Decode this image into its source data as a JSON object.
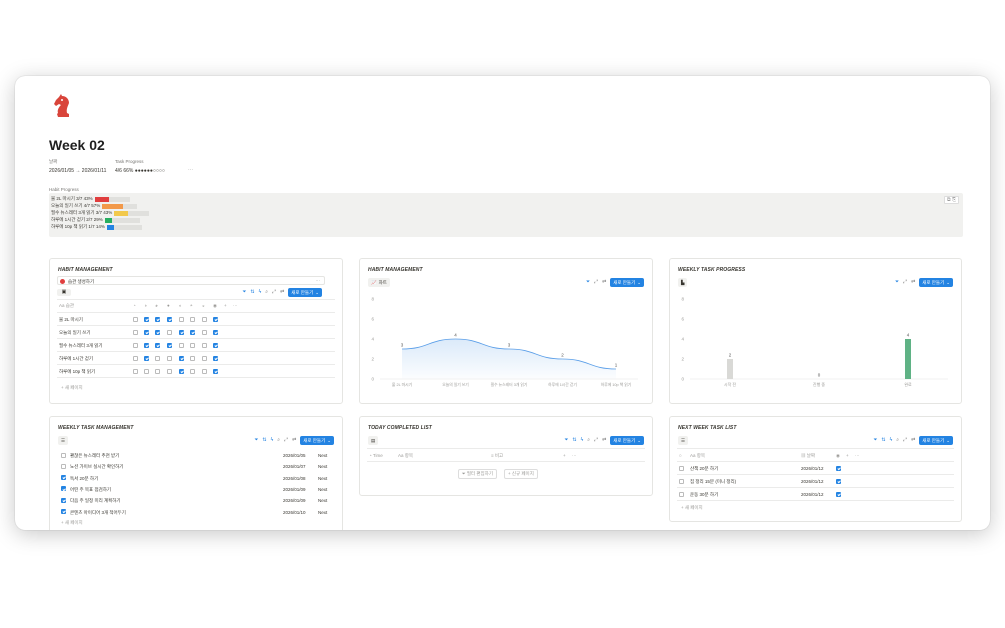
{
  "page": {
    "title": "Week 02",
    "icon": "chess-knight-icon",
    "date_label": "날짜",
    "date_value": "2026/01/05 → 2026/01/11",
    "task_label": "Task Progress",
    "task_value": "4/6 66% ●●●●●●○○○○",
    "more": "···"
  },
  "habit_progress": {
    "label": "Habit Progress",
    "rows": [
      {
        "text": "물 2L 마시기 3/7 43%",
        "fraction": 0.43,
        "color": "#e03e3e"
      },
      {
        "text": "오늘의 일기 쓰기 4/7 57%",
        "fraction": 0.57,
        "color": "#f2994a"
      },
      {
        "text": "필수 뉴스레터 3개 읽기 3/7 43%",
        "fraction": 0.43,
        "color": "#f2c94c"
      },
      {
        "text": "하루에 1시간 걷기 2/7 29%",
        "fraction": 0.29,
        "color": "#27ae60"
      },
      {
        "text": "하루에 10p 책 읽기 1/7 14%",
        "fraction": 0.14,
        "color": "#2383e2"
      }
    ]
  },
  "habit_card": {
    "title": "HABIT MANAGEMENT",
    "banner": "습관 생성하기",
    "banner_more": "···",
    "new_label": "새로 만들기",
    "col_name": "습관",
    "plus": "+",
    "more": "···",
    "rows": [
      {
        "name": "물 2L 마시기",
        "checks": [
          false,
          true,
          true,
          true,
          false,
          false,
          false,
          true
        ]
      },
      {
        "name": "오늘의 일기 쓰기",
        "checks": [
          false,
          true,
          true,
          false,
          true,
          true,
          false,
          true
        ]
      },
      {
        "name": "필수 뉴스레터 3개 읽기",
        "checks": [
          false,
          true,
          true,
          true,
          false,
          false,
          false,
          true
        ]
      },
      {
        "name": "하루에 1시간 걷기",
        "checks": [
          false,
          true,
          false,
          false,
          true,
          false,
          false,
          true
        ]
      },
      {
        "name": "하루에 10p 책 읽기",
        "checks": [
          false,
          false,
          false,
          false,
          true,
          false,
          false,
          true
        ]
      }
    ],
    "add_label": "새 페이지"
  },
  "chart_card": {
    "title": "HABIT MANAGEMENT",
    "view_label": "차트",
    "new_label": "새로 만들기"
  },
  "progress_card": {
    "title": "WEEKLY TASK PROGRESS",
    "new_label": "새로 만들기"
  },
  "weekly_card": {
    "title": "WEEKLY TASK MANAGEMENT",
    "new_label": "새로 만들기",
    "rows": [
      {
        "name": "괜찮은 뉴스레터 추천 받기",
        "date": "2026/01/05",
        "status": "Next",
        "done": false
      },
      {
        "name": "노션 가이브 실시간 확인하기",
        "date": "2026/01/07",
        "status": "Next",
        "done": false
      },
      {
        "name": "독서 20분 하기",
        "date": "2026/01/08",
        "status": "Next",
        "done": true
      },
      {
        "name": "어떤 주 목표 점검하기",
        "date": "2026/01/09",
        "status": "Next",
        "done": true
      },
      {
        "name": "다음 주 일정 미리 계획하기",
        "date": "2026/01/09",
        "status": "Next",
        "done": true
      },
      {
        "name": "콘텐츠 아이디어 3개 적어두기",
        "date": "2026/01/10",
        "status": "Next",
        "done": true
      }
    ],
    "add_label": "새 페이지"
  },
  "today_card": {
    "title": "TODAY COMPLETED LIST",
    "new_label": "새로 만들기",
    "col_time": "Time",
    "col_name": "항목",
    "col_note": "비고",
    "plus": "+",
    "more": "···",
    "filter_btn": "필터 편집하기",
    "new_page_btn": "신규 페이지"
  },
  "next_card": {
    "title": "NEXT WEEK TASK LIST",
    "new_label": "새로 만들기",
    "col_name": "항목",
    "col_date": "날짜",
    "plus": "+",
    "more": "···",
    "rows": [
      {
        "name": "산책 20분 하기",
        "date": "2026/01/12",
        "done": true
      },
      {
        "name": "집 정리 15분 (미니 정리)",
        "date": "2026/01/12",
        "done": true
      },
      {
        "name": "운동 30분 하기",
        "date": "2026/01/12",
        "done": true
      }
    ],
    "add_label": "새 페이지"
  },
  "chart_data": [
    {
      "type": "area",
      "title": "",
      "categories": [
        "물 2L 마시기",
        "오늘의 일기 쓰기",
        "필수 뉴스레터 3개 읽기",
        "하루에 1시간 걷기",
        "하루에 10p 책 읽기"
      ],
      "values": [
        3,
        4,
        3,
        2,
        1
      ],
      "yticks": [
        0,
        2,
        4,
        6,
        8
      ],
      "ylim": [
        0,
        8
      ],
      "color": "#5a9ee8"
    },
    {
      "type": "bar",
      "title": "",
      "categories": [
        "시작 전",
        "진행 중",
        "완료"
      ],
      "values": [
        2,
        0,
        4
      ],
      "colors": [
        "#d9d9d6",
        "#d9d9d6",
        "#5fb285"
      ],
      "yticks": [
        0,
        2,
        4,
        6,
        8
      ],
      "ylim": [
        0,
        8
      ]
    }
  ],
  "colors": {
    "accent": "#2383e2",
    "brand": "#d9453b"
  }
}
